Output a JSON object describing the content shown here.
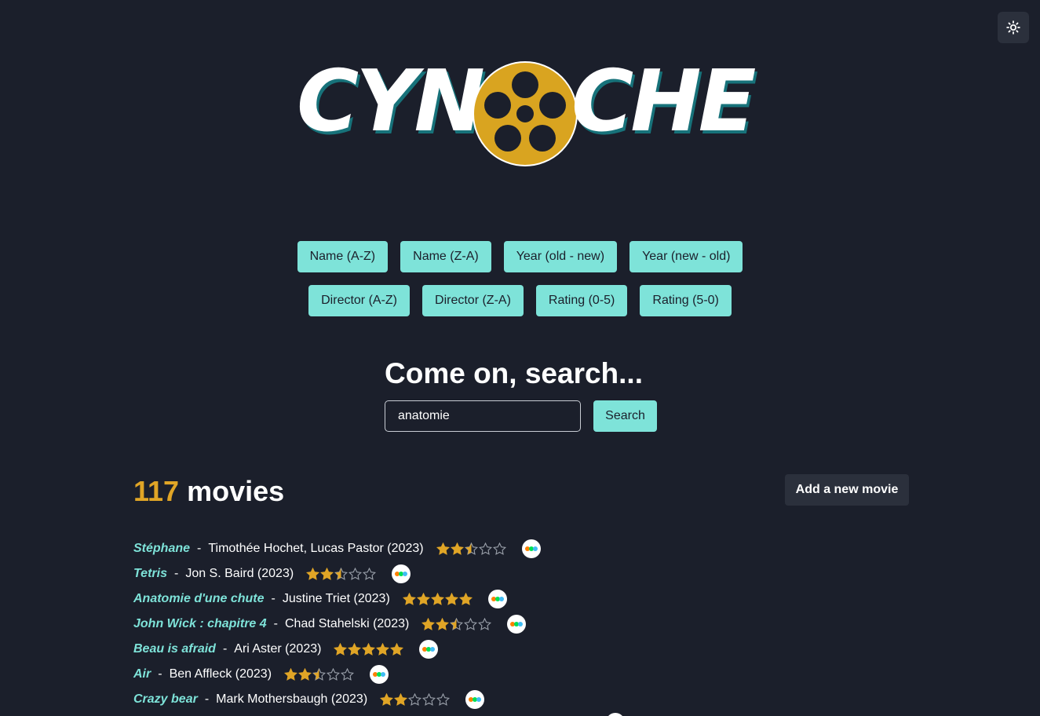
{
  "header": {
    "theme_toggle_icon": "sun-icon",
    "logo": {
      "text_left": "CYN",
      "text_right": "CHE",
      "reel_color": "#d9a420",
      "text_color": "#ffffff",
      "shadow_color": "#17727a"
    }
  },
  "sort_buttons": [
    [
      "Name (A-Z)",
      "Name (Z-A)",
      "Year (old - new)",
      "Year (new - old)"
    ],
    [
      "Director (A-Z)",
      "Director (Z-A)",
      "Rating (0-5)",
      "Rating (5-0)"
    ]
  ],
  "search": {
    "title": "Come on, search...",
    "value": "anatomie",
    "button_label": "Search"
  },
  "results": {
    "count": "117",
    "count_label": "movies",
    "add_button_label": "Add a new movie"
  },
  "movies": [
    {
      "title": "Stéphane",
      "director": "Timothée Hochet, Lucas Pastor",
      "year": "2023",
      "rating": 2.5
    },
    {
      "title": "Tetris",
      "director": "Jon S. Baird",
      "year": "2023",
      "rating": 2.5
    },
    {
      "title": "Anatomie d'une chute",
      "director": "Justine Triet",
      "year": "2023",
      "rating": 5
    },
    {
      "title": "John Wick : chapitre 4",
      "director": "Chad Stahelski",
      "year": "2023",
      "rating": 2.5
    },
    {
      "title": "Beau is afraid",
      "director": "Ari Aster",
      "year": "2023",
      "rating": 5
    },
    {
      "title": "Air",
      "director": "Ben Affleck",
      "year": "2023",
      "rating": 2.5
    },
    {
      "title": "Crazy bear",
      "director": "Mark Mothersbaugh",
      "year": "2023",
      "rating": 2
    }
  ],
  "colors": {
    "background": "#1b1f2b",
    "accent": "#7ee3d9",
    "star": "#e0a526",
    "count": "#e0a526",
    "surface": "#2b303c"
  },
  "icons": {
    "star": "star-icon",
    "half_star": "star-half-icon",
    "empty_star": "star-empty-icon",
    "letterboxd": "letterboxd-icon"
  }
}
